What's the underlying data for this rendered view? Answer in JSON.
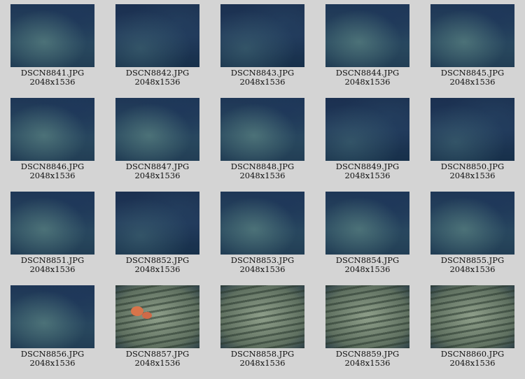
{
  "thumbnails": [
    {
      "name": "DSCN8841.JPG",
      "dims": "2048x1536",
      "tone": "mid"
    },
    {
      "name": "DSCN8842.JPG",
      "dims": "2048x1536",
      "tone": "dark"
    },
    {
      "name": "DSCN8843.JPG",
      "dims": "2048x1536",
      "tone": "dark"
    },
    {
      "name": "DSCN8844.JPG",
      "dims": "2048x1536",
      "tone": "mid"
    },
    {
      "name": "DSCN8845.JPG",
      "dims": "2048x1536",
      "tone": "mid"
    },
    {
      "name": "DSCN8846.JPG",
      "dims": "2048x1536",
      "tone": "mid"
    },
    {
      "name": "DSCN8847.JPG",
      "dims": "2048x1536",
      "tone": "mid"
    },
    {
      "name": "DSCN8848.JPG",
      "dims": "2048x1536",
      "tone": "mid"
    },
    {
      "name": "DSCN8849.JPG",
      "dims": "2048x1536",
      "tone": "dark"
    },
    {
      "name": "DSCN8850.JPG",
      "dims": "2048x1536",
      "tone": "dark"
    },
    {
      "name": "DSCN8851.JPG",
      "dims": "2048x1536",
      "tone": "mid"
    },
    {
      "name": "DSCN8852.JPG",
      "dims": "2048x1536",
      "tone": "dark"
    },
    {
      "name": "DSCN8853.JPG",
      "dims": "2048x1536",
      "tone": "mid"
    },
    {
      "name": "DSCN8854.JPG",
      "dims": "2048x1536",
      "tone": "mid"
    },
    {
      "name": "DSCN8855.JPG",
      "dims": "2048x1536",
      "tone": "mid"
    },
    {
      "name": "DSCN8856.JPG",
      "dims": "2048x1536",
      "tone": "mid"
    },
    {
      "name": "DSCN8857.JPG",
      "dims": "2048x1536",
      "tone": "light coral"
    },
    {
      "name": "DSCN8858.JPG",
      "dims": "2048x1536",
      "tone": "light"
    },
    {
      "name": "DSCN8859.JPG",
      "dims": "2048x1536",
      "tone": "light"
    },
    {
      "name": "DSCN8860.JPG",
      "dims": "2048x1536",
      "tone": "light"
    }
  ]
}
